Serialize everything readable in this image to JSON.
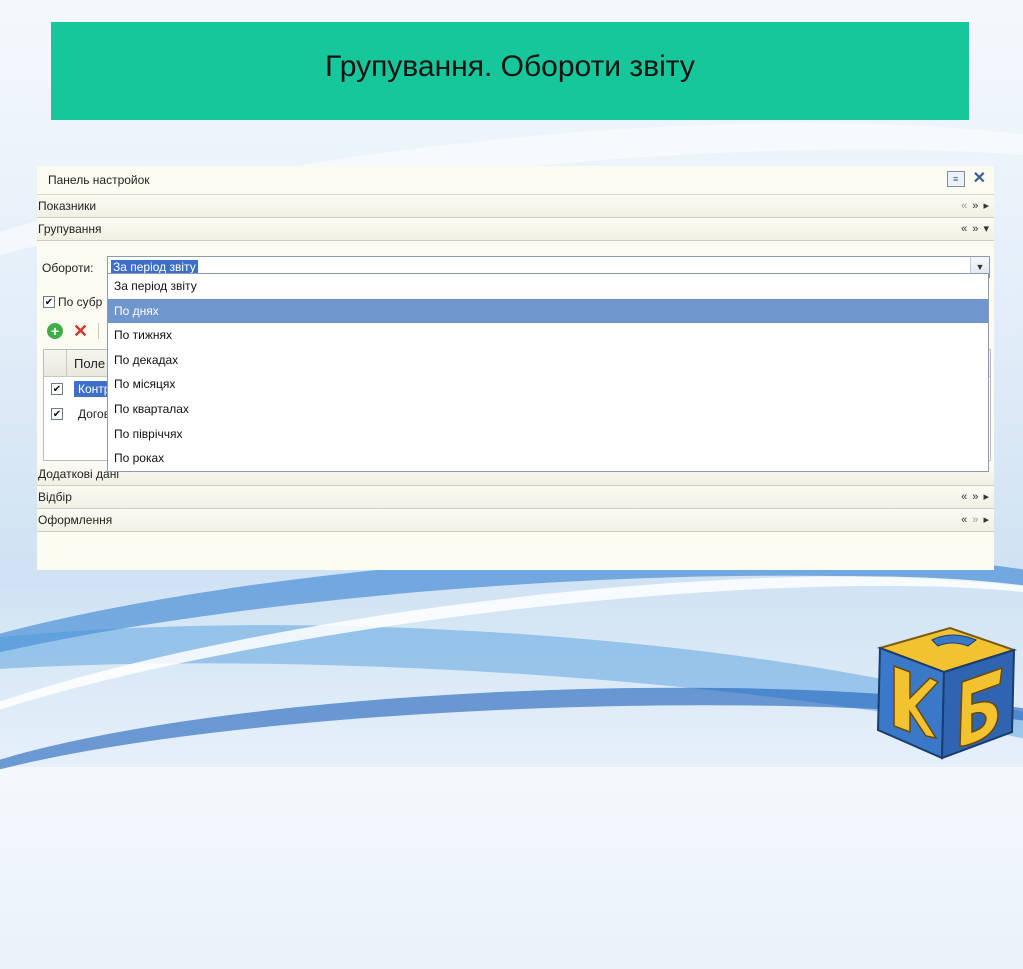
{
  "slide": {
    "title": "Групування. Обороти звіту",
    "title_bg": "#16c79b"
  },
  "panel": {
    "header": "Панель настройок",
    "sections": {
      "indicators": "Показники",
      "grouping": "Групування",
      "extra": "Додаткові дані",
      "filter": "Відбір",
      "design": "Оформлення"
    },
    "oboroty_label": "Обороти:",
    "oboroty_value": "За період звіту",
    "checkbox_label": "По субр",
    "grid": {
      "column": "Поле",
      "rows": [
        "Контр",
        "Догов"
      ]
    },
    "dropdown": {
      "options": [
        "За період звіту",
        "По днях",
        "По тижнях",
        "По декадах",
        "По місяцях",
        "По кварталах",
        "По півріччях",
        "По роках"
      ],
      "selected": "По днях",
      "selected_color": "#7097cd"
    }
  },
  "icons": [
    "settings-icon",
    "close-icon",
    "add-icon",
    "delete-icon",
    "chevron-down-icon",
    "checkbox-checked-icon",
    "logo-icon"
  ]
}
